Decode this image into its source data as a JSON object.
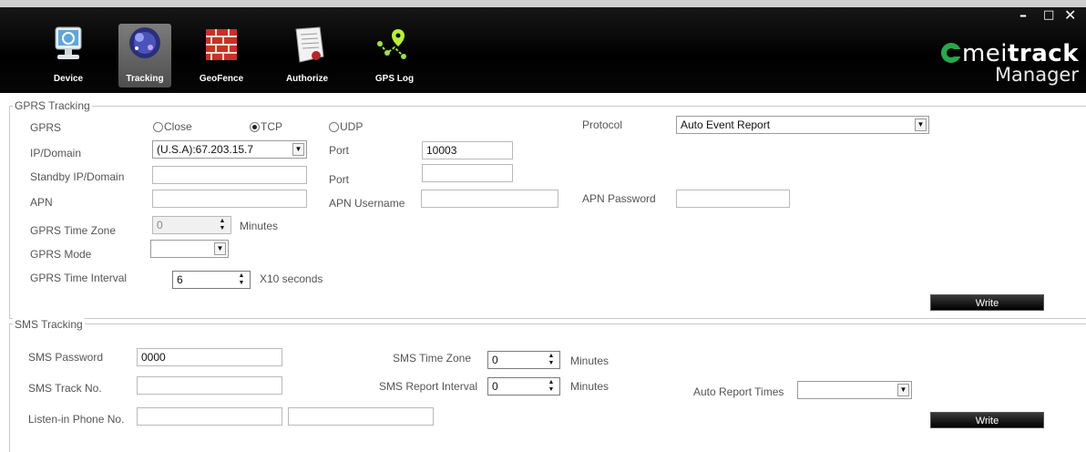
{
  "window": {
    "minimize": "–",
    "maximize": "□",
    "close": "✕"
  },
  "toolbar": {
    "items": [
      {
        "label": "Device",
        "icon": "monitor-icon"
      },
      {
        "label": "Tracking",
        "icon": "radar-globe-icon",
        "active": true
      },
      {
        "label": "GeoFence",
        "icon": "brick-wall-icon"
      },
      {
        "label": "Authorize",
        "icon": "certificate-icon"
      },
      {
        "label": "GPS Log",
        "icon": "gps-log-icon"
      }
    ]
  },
  "logo": {
    "brand_prefix": "mei",
    "brand_suffix": "track",
    "sub": "Manager",
    "accent": "#2aa84a"
  },
  "gprs": {
    "title": "GPRS Tracking",
    "gprs_label": "GPRS",
    "radio_close": "Close",
    "radio_tcp": "TCP",
    "radio_udp": "UDP",
    "selected": "TCP",
    "protocol_label": "Protocol",
    "protocol_value": "Auto Event Report",
    "ip_label": "IP/Domain",
    "ip_value": "(U.S.A):67.203.15.7",
    "port_label": "Port",
    "port_value": "10003",
    "standby_label": "Standby IP/Domain",
    "standby_value": "",
    "port2_label": "Port",
    "port2_value": "",
    "apn_label": "APN",
    "apn_value": "",
    "apn_user_label": "APN Username",
    "apn_user_value": "",
    "apn_pass_label": "APN Password",
    "apn_pass_value": "",
    "timezone_label": "GPRS Time Zone",
    "timezone_value": "0",
    "timezone_unit": "Minutes",
    "mode_label": "GPRS Mode",
    "mode_value": "",
    "interval_label": "GPRS Time Interval",
    "interval_value": "6",
    "interval_unit": "X10 seconds",
    "write": "Write"
  },
  "sms": {
    "title": "SMS Tracking",
    "password_label": "SMS Password",
    "password_value": "0000",
    "timezone_label": "SMS Time Zone",
    "timezone_value": "0",
    "timezone_unit": "Minutes",
    "track_label": "SMS Track No.",
    "track_value": "",
    "report_interval_label": "SMS Report Interval",
    "report_interval_value": "0",
    "report_interval_unit": "Minutes",
    "auto_report_label": "Auto Report Times",
    "auto_report_value": "",
    "listen_label": "Listen-in Phone No.",
    "listen_value_1": "",
    "listen_value_2": "",
    "write": "Write"
  }
}
